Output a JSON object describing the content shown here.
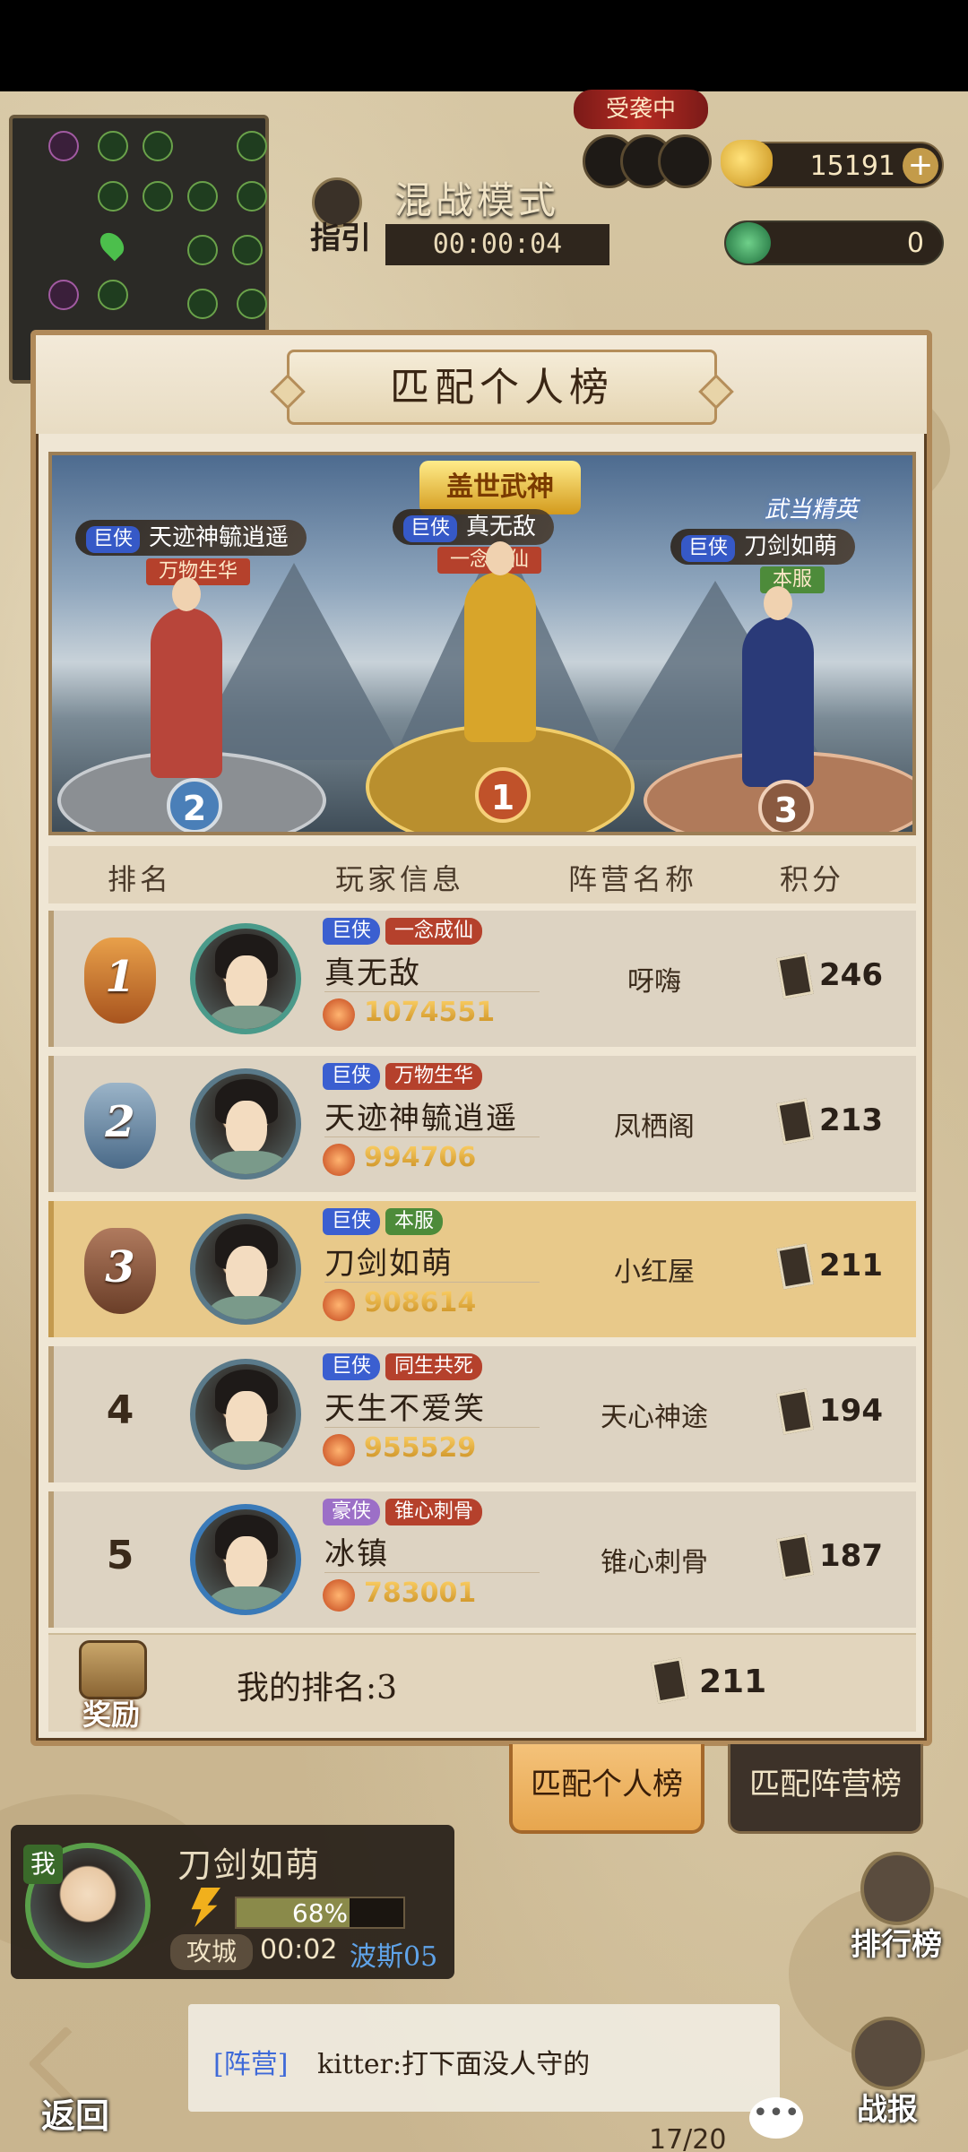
{
  "hud": {
    "attack_status": "受袭中",
    "gold": "15191",
    "jade": "0",
    "guide_label": "指引",
    "mode_title": "混战模式",
    "mode_timer": "00:00:04"
  },
  "panel": {
    "title": "匹配个人榜",
    "podium": {
      "crown_label": "盖世武神",
      "elite_label": "武当精英",
      "first": {
        "rank": "1",
        "title": "巨侠",
        "name": "真无敌",
        "tag": "一念成仙"
      },
      "second": {
        "rank": "2",
        "title": "巨侠",
        "name": "天迹神毓逍遥",
        "tag": "万物生华"
      },
      "third": {
        "rank": "3",
        "title": "巨侠",
        "name": "刀剑如萌",
        "tag": "本服"
      }
    },
    "columns": [
      "排名",
      "玩家信息",
      "阵营名称",
      "积分"
    ],
    "rows": [
      {
        "rank": "1",
        "title": "巨侠",
        "tag": "一念成仙",
        "name": "真无敌",
        "power": "1074551",
        "camp": "呀嗨",
        "score": "246"
      },
      {
        "rank": "2",
        "title": "巨侠",
        "tag": "万物生华",
        "name": "天迹神毓逍遥",
        "power": "994706",
        "camp": "凤栖阁",
        "score": "213"
      },
      {
        "rank": "3",
        "title": "巨侠",
        "tag": "本服",
        "name": "刀剑如萌",
        "power": "908614",
        "camp": "小红屋",
        "score": "211"
      },
      {
        "rank": "4",
        "title": "巨侠",
        "tag": "同生共死",
        "name": "天生不爱笑",
        "power": "955529",
        "camp": "天心神途",
        "score": "194"
      },
      {
        "rank": "5",
        "title": "豪侠",
        "tag": "锥心刺骨",
        "name": "冰镇",
        "power": "783001",
        "camp": "锥心刺骨",
        "score": "187"
      }
    ],
    "reward_label": "奖励",
    "my_rank": "我的排名:3",
    "my_score": "211"
  },
  "tabs": {
    "active": "匹配个人榜",
    "inactive": "匹配阵营榜"
  },
  "player_card": {
    "me_mark": "我",
    "name": "刀剑如萌",
    "energy_pct": "68%",
    "energy_fraction": 0.68,
    "action": "攻城",
    "action_time": "00:02",
    "target": "波斯05"
  },
  "side": {
    "ranking": "排行榜",
    "battle_report": "战报",
    "back": "返回"
  },
  "chat": {
    "channel": "[阵营]",
    "message": "kitter:打下面没人守的"
  },
  "bottom_progress": "17/20",
  "colors": {
    "accent_gold": "#e7a64e",
    "highlight_row": "#e8c98a",
    "chip_blue": "#3b5fd0",
    "chip_red": "#b5412c"
  }
}
